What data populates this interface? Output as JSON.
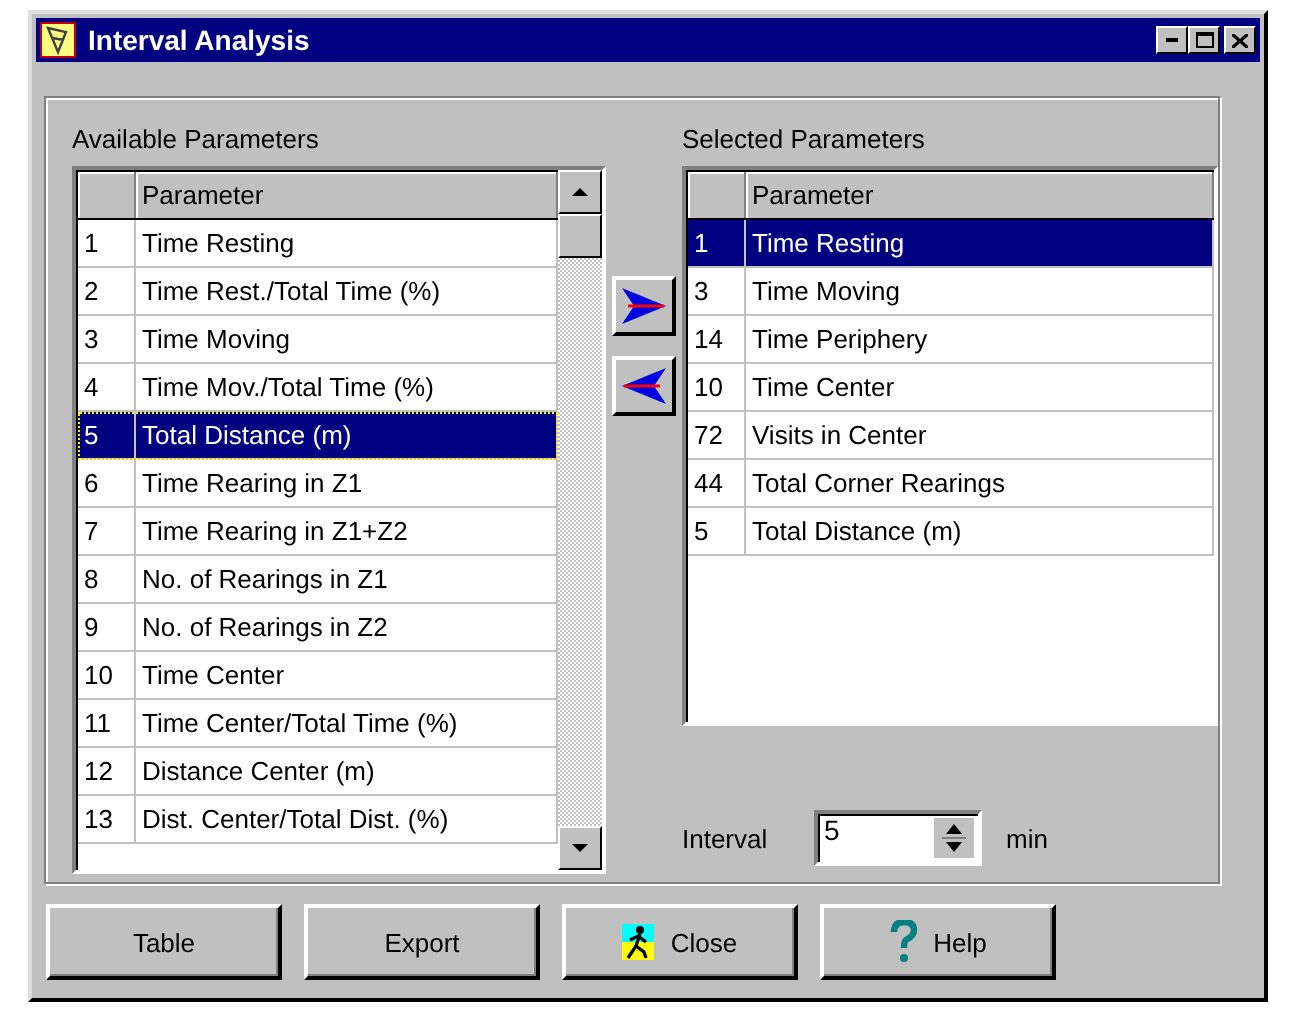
{
  "window": {
    "title": "Interval Analysis"
  },
  "available": {
    "label": "Available Parameters",
    "column_header": "Parameter",
    "rows": [
      {
        "number": "1",
        "parameter": "Time Resting",
        "selected": false,
        "focused": false
      },
      {
        "number": "2",
        "parameter": "Time Rest./Total Time (%)",
        "selected": false,
        "focused": false
      },
      {
        "number": "3",
        "parameter": "Time Moving",
        "selected": false,
        "focused": false
      },
      {
        "number": "4",
        "parameter": "Time Mov./Total Time (%)",
        "selected": false,
        "focused": false
      },
      {
        "number": "5",
        "parameter": "Total Distance (m)",
        "selected": true,
        "focused": true
      },
      {
        "number": "6",
        "parameter": "Time Rearing in Z1",
        "selected": false,
        "focused": false
      },
      {
        "number": "7",
        "parameter": "Time Rearing in Z1+Z2",
        "selected": false,
        "focused": false
      },
      {
        "number": "8",
        "parameter": "No. of Rearings in Z1",
        "selected": false,
        "focused": false
      },
      {
        "number": "9",
        "parameter": "No. of Rearings in Z2",
        "selected": false,
        "focused": false
      },
      {
        "number": "10",
        "parameter": "Time Center",
        "selected": false,
        "focused": false
      },
      {
        "number": "11",
        "parameter": "Time Center/Total Time (%)",
        "selected": false,
        "focused": false
      },
      {
        "number": "12",
        "parameter": "Distance Center (m)",
        "selected": false,
        "focused": false
      },
      {
        "number": "13",
        "parameter": "Dist. Center/Total Dist. (%)",
        "selected": false,
        "focused": false
      }
    ]
  },
  "selected": {
    "label": "Selected Parameters",
    "column_header": "Parameter",
    "rows": [
      {
        "number": "1",
        "parameter": "Time Resting",
        "selected": true,
        "focused": false
      },
      {
        "number": "3",
        "parameter": "Time Moving",
        "selected": false,
        "focused": false
      },
      {
        "number": "14",
        "parameter": "Time Periphery",
        "selected": false,
        "focused": false
      },
      {
        "number": "10",
        "parameter": "Time Center",
        "selected": false,
        "focused": false
      },
      {
        "number": "72",
        "parameter": "Visits in Center",
        "selected": false,
        "focused": false
      },
      {
        "number": "44",
        "parameter": "Total Corner Rearings",
        "selected": false,
        "focused": false
      },
      {
        "number": "5",
        "parameter": "Total Distance (m)",
        "selected": false,
        "focused": false
      }
    ]
  },
  "interval": {
    "label": "Interval",
    "value": "5",
    "unit": "min"
  },
  "buttons": [
    {
      "label": "Table",
      "kind": "plain"
    },
    {
      "label": "Export",
      "kind": "plain"
    },
    {
      "label": "Close",
      "kind": "exit"
    },
    {
      "label": "Help",
      "kind": "help"
    }
  ]
}
